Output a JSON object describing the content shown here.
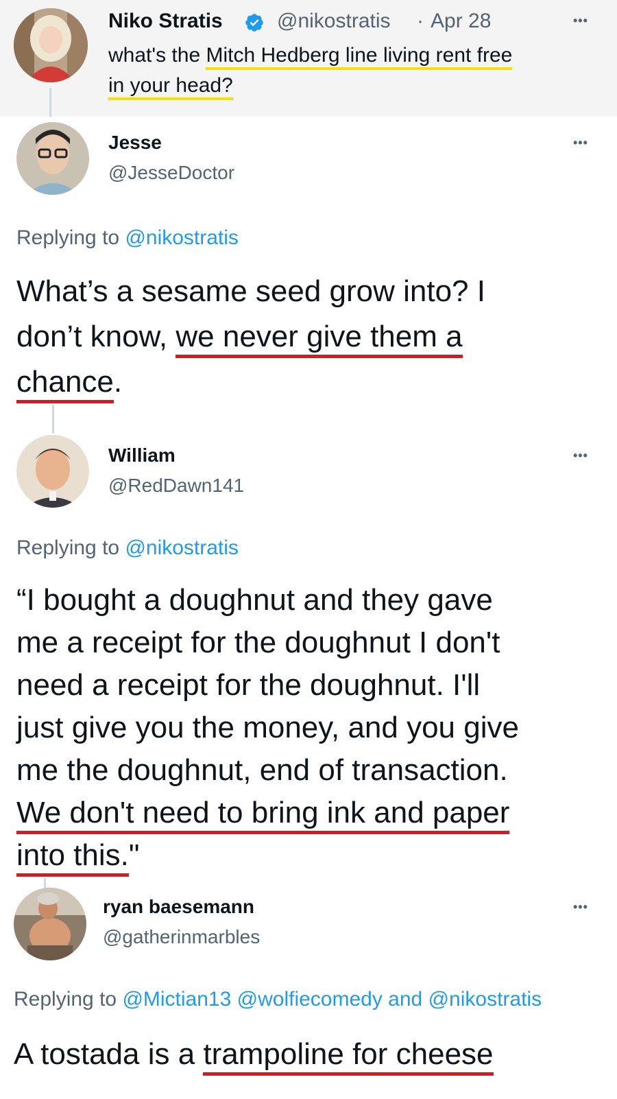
{
  "tweet1": {
    "name": "Niko Stratis",
    "handle": "@nikostratis",
    "sep": "·",
    "date": "Apr 28",
    "more": "•••",
    "line1_pre": "what's the ",
    "line1_hl": "Mitch Hedberg line living rent free",
    "line2_hl": "in your head?"
  },
  "reply1": {
    "name": "Jesse",
    "handle": "@JesseDoctor",
    "more": "•••",
    "replying_prefix": "Replying to ",
    "replying_handle": "@nikostratis",
    "line1": "What’s a sesame seed grow into? I",
    "line2_pre": "don’t know, ",
    "line2_hl": "we never give them a",
    "line3_hl": "chance",
    "line3_post": "."
  },
  "reply2": {
    "name": "William",
    "handle": "@RedDawn141",
    "more": "•••",
    "replying_prefix": "Replying to ",
    "replying_handle": "@nikostratis",
    "line1": "“I bought a doughnut and they gave",
    "line2": "me a receipt for the doughnut I don't",
    "line3": "need a receipt for the doughnut. I'll",
    "line4": "just give you the money, and you give",
    "line5": "me the doughnut, end of transaction.",
    "line6_hl": "We don't need to bring ink and paper",
    "line7_hl": "into this.",
    "line7_post": "\""
  },
  "reply3": {
    "name": "ryan baesemann",
    "handle": "@gatherinmarbles",
    "more": "•••",
    "replying_prefix": "Replying to ",
    "replying_handle1": "@Mictian13",
    "replying_handle2": "@wolfiecomedy",
    "replying_and": " and ",
    "replying_handle3": "@nikostratis",
    "line1_pre": "A tostada is a ",
    "line1_hl": "trampoline for cheese"
  },
  "colors": {
    "link": "#1d9bf0",
    "muted": "#536471",
    "highlight_yellow": "#f5e000",
    "underline_red": "#e3141c",
    "verified_blue": "#1d9bf0"
  },
  "icons": [
    "verified-badge-icon",
    "more-options-icon"
  ]
}
